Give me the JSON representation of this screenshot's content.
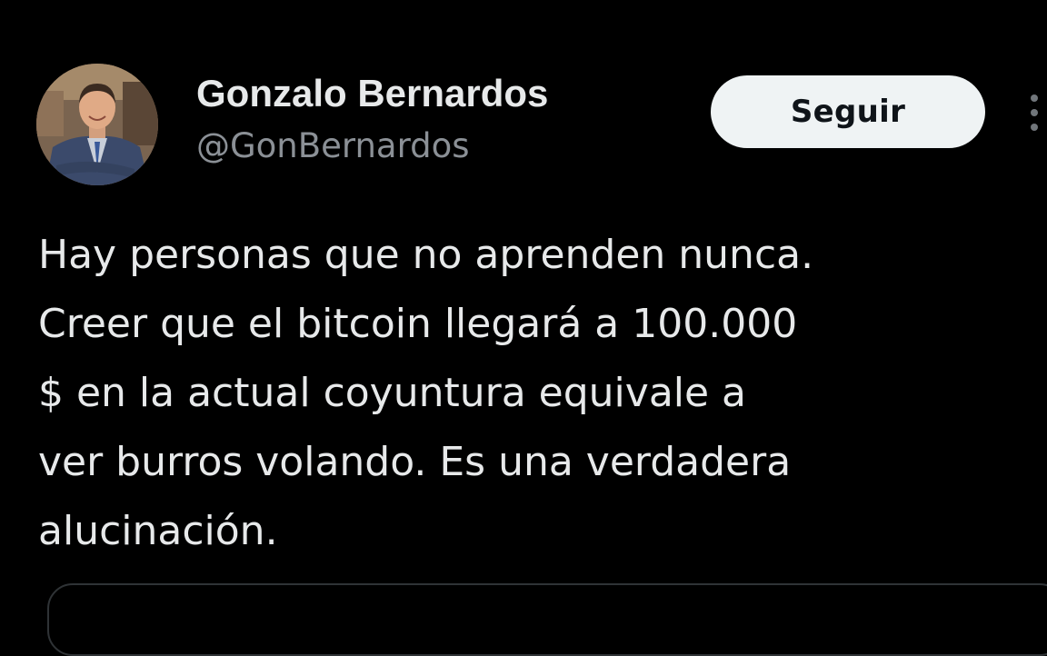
{
  "user": {
    "display_name": "Gonzalo Bernardos",
    "handle": "@GonBernardos",
    "avatar_icon": "profile-photo"
  },
  "actions": {
    "follow_label": "Seguir",
    "more_icon": "more-vertical-icon"
  },
  "tweet": {
    "lines": [
      "Hay personas que no aprenden nunca.",
      "Creer que el bitcoin llegará a 100.000",
      "$ en la actual coyuntura equivale a",
      "ver burros volando. Es una verdadera",
      "alucinación."
    ]
  },
  "colors": {
    "background": "#000000",
    "primary_text": "#e7e9ea",
    "secondary_text": "#8b9096",
    "button_bg": "#eff3f4",
    "button_text": "#0f1419",
    "border": "#2f3336"
  }
}
